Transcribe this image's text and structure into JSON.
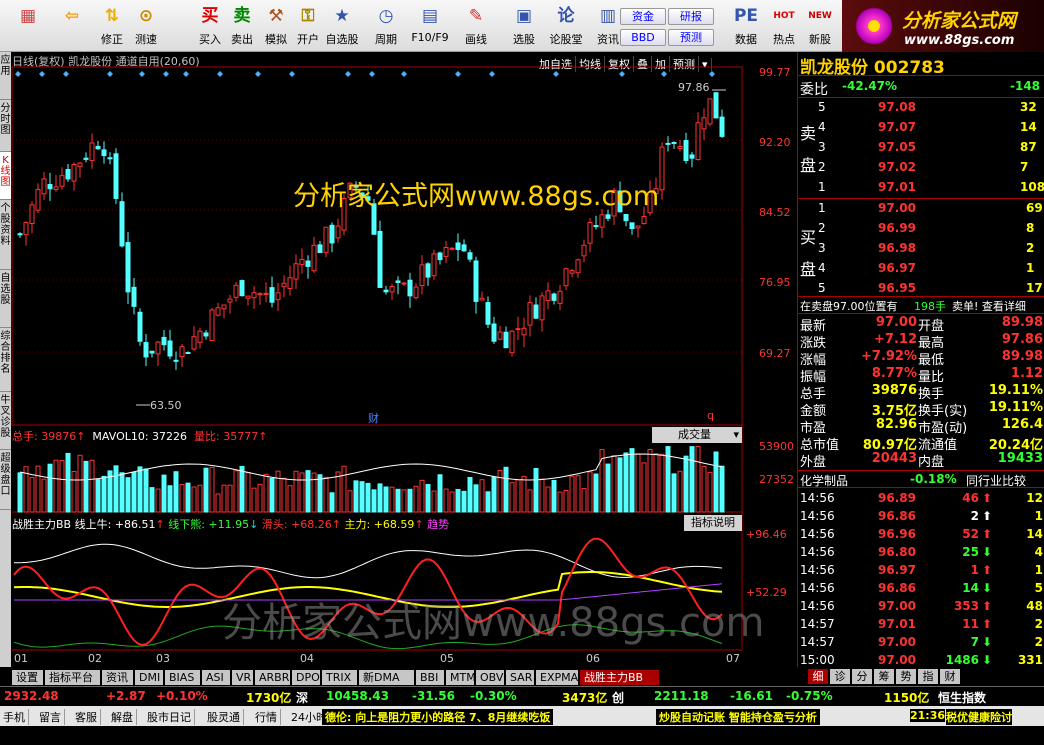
{
  "toolbar": {
    "items": [
      {
        "label": "",
        "icon": "ie-grid-icon",
        "glyph": "▦"
      },
      {
        "label": "",
        "icon": "back-arrow-icon",
        "glyph": "⇦"
      },
      {
        "label": "修正",
        "icon": "revise-icon",
        "glyph": "⇅"
      },
      {
        "label": "测速",
        "icon": "speed-test-icon",
        "glyph": "⊙"
      },
      {
        "label": "买入",
        "icon": "buy-icon",
        "glyph": "买"
      },
      {
        "label": "卖出",
        "icon": "sell-icon",
        "glyph": "卖"
      },
      {
        "label": "模拟",
        "icon": "hammer-icon",
        "glyph": "⚒"
      },
      {
        "label": "开户",
        "icon": "lock-icon",
        "glyph": "⚿"
      },
      {
        "label": "自选股",
        "icon": "star-icon",
        "glyph": "★"
      },
      {
        "label": "周期",
        "icon": "clock-icon",
        "glyph": "◷"
      },
      {
        "label": "F10/F9",
        "icon": "f10-icon",
        "glyph": "▤"
      },
      {
        "label": "画线",
        "icon": "pencil-icon",
        "glyph": "✎"
      },
      {
        "label": "选股",
        "icon": "screen-icon",
        "glyph": "▣"
      },
      {
        "label": "论股堂",
        "icon": "lun-icon",
        "glyph": "论"
      },
      {
        "label": "资讯",
        "icon": "news-icon",
        "glyph": "▥"
      },
      {
        "label": "数据",
        "icon": "pe-icon",
        "glyph": "PE"
      },
      {
        "label": "热点",
        "icon": "hot-icon",
        "glyph": "HOT"
      },
      {
        "label": "新股",
        "icon": "newstock-icon",
        "glyph": "NEW"
      }
    ],
    "pills": [
      "资金",
      "研报",
      "BBD",
      "预测"
    ]
  },
  "logo": {
    "line1": "分析家公式网",
    "line2": "www.88gs.com"
  },
  "left_tabs": [
    "应用",
    "分时图",
    "K线图",
    "个股资料",
    "自选股",
    "综合排名",
    "牛叉诊股",
    "超级盘口"
  ],
  "chart": {
    "header": "日线(复权)  凯龙股份 通道自用(20,60)",
    "buttons": [
      "加自选",
      "均线",
      "复权",
      "叠",
      "加",
      "预测"
    ],
    "price_ticks": [
      "99.77",
      "92.20",
      "84.52",
      "76.95",
      "69.27"
    ],
    "low_label": "63.50",
    "high_label": "97.86",
    "markers": [
      "财",
      "q"
    ],
    "watermark_top": "分析家公式网www.88gs.com",
    "watermark_bottom": "分析家公式网www.88gs.com"
  },
  "volume": {
    "total": "总手: 39876",
    "mavol": "MAVOL10: 37226",
    "ratio": "量比: 35777",
    "dropdown": "成交量",
    "ticks": [
      "53900",
      "27352"
    ]
  },
  "indicator": {
    "name": "战胜主力BB",
    "items": [
      "线上牛: +86.51",
      "线下熊: +11.95",
      "滑头: +68.26",
      "主力: +68.59",
      "趋势"
    ],
    "help": "指标说明",
    "ticks": [
      "+96.46",
      "+52.29"
    ]
  },
  "x_labels": [
    "01",
    "02",
    "03",
    "04",
    "05",
    "06",
    "07"
  ],
  "bottom_tabs": [
    "设置",
    "指标平台",
    "资讯",
    "DMI",
    "BIAS",
    "ASI",
    "VR",
    "ARBR",
    "DPO",
    "TRIX",
    "新DMA",
    "BBI",
    "MTM",
    "OBV",
    "SAR",
    "EXPMA",
    "战胜主力BB"
  ],
  "right": {
    "title": "凯龙股份 002783",
    "weibi": {
      "label": "委比",
      "value": "-42.47%",
      "diff": "-148"
    },
    "sell_label": [
      "卖",
      "盘"
    ],
    "buy_label": [
      "买",
      "盘"
    ],
    "asks": [
      [
        "5",
        "97.08",
        "32"
      ],
      [
        "4",
        "97.07",
        "14"
      ],
      [
        "3",
        "97.05",
        "87"
      ],
      [
        "2",
        "97.02",
        "7"
      ],
      [
        "1",
        "97.01",
        "108"
      ]
    ],
    "bids": [
      [
        "1",
        "97.00",
        "69"
      ],
      [
        "2",
        "96.99",
        "8"
      ],
      [
        "3",
        "96.98",
        "2"
      ],
      [
        "4",
        "96.97",
        "1"
      ],
      [
        "5",
        "96.95",
        "17"
      ]
    ],
    "notice": "在卖盘97.00位置有",
    "notice_qty": "198手",
    "notice_tail": "卖单! 查看详细",
    "stats": [
      [
        "最新",
        "97.00",
        "开盘",
        "89.98"
      ],
      [
        "涨跌",
        "+7.12",
        "最高",
        "97.86"
      ],
      [
        "涨幅",
        "+7.92%",
        "最低",
        "89.98"
      ],
      [
        "振幅",
        "8.77%",
        "量比",
        "1.12"
      ],
      [
        "总手",
        "39876",
        "换手",
        "19.11%"
      ],
      [
        "金额",
        "3.75亿",
        "换手(实)",
        "19.11%"
      ],
      [
        "市盈",
        "82.96",
        "市盈(动)",
        "126.4"
      ],
      [
        "总市值",
        "80.97亿",
        "流通值",
        "20.24亿"
      ],
      [
        "外盘",
        "20443",
        "内盘",
        "19433"
      ]
    ],
    "industry": "化学制品",
    "industry_pct": "-0.18%",
    "compare": "同行业比较",
    "ticks": [
      [
        "14:56",
        "96.89",
        "46",
        "up",
        "12"
      ],
      [
        "14:56",
        "96.86",
        "2",
        "flat",
        "1"
      ],
      [
        "14:56",
        "96.96",
        "52",
        "up",
        "14"
      ],
      [
        "14:56",
        "96.80",
        "25",
        "down",
        "4"
      ],
      [
        "14:56",
        "96.97",
        "1",
        "up",
        "1"
      ],
      [
        "14:56",
        "96.86",
        "14",
        "down",
        "5"
      ],
      [
        "14:56",
        "97.00",
        "353",
        "up",
        "48"
      ],
      [
        "14:57",
        "97.01",
        "11",
        "up",
        "2"
      ],
      [
        "14:57",
        "97.00",
        "7",
        "down",
        "2"
      ],
      [
        "15:00",
        "97.00",
        "1486",
        "down",
        "331"
      ]
    ],
    "tabs": [
      "细",
      "诊",
      "分",
      "筹",
      "势",
      "指",
      "财"
    ]
  },
  "status": {
    "idx1": "2932.48",
    "ch1": "+2.87",
    "pct1": "+0.10%",
    "amt1": "1730亿",
    "n2": "深",
    "idx2": "10458.43",
    "ch2": "-31.56",
    "pct2": "-0.30%",
    "amt2": "3473亿",
    "n3": "创",
    "idx3": "2211.18",
    "ch3": "-16.61",
    "pct3": "-0.75%",
    "amt3": "1150亿",
    "n4": "恒生指数"
  },
  "status2": {
    "items": [
      "手机",
      "留言",
      "客服",
      "解盘",
      "股市日记",
      "股灵通",
      "行情",
      "24小时滚动"
    ],
    "ticker1": "德伦: 向上是阻力更小的路径 7、8月继续吃饭",
    "ticker2": "炒股自动记账 智能持仓盈亏分析",
    "time": "21:36",
    "tail": "税优健康险讨"
  },
  "colors": {
    "up": "#ff3232",
    "down": "#54ffff",
    "yellow": "#ffff00",
    "bg": "#000000"
  }
}
